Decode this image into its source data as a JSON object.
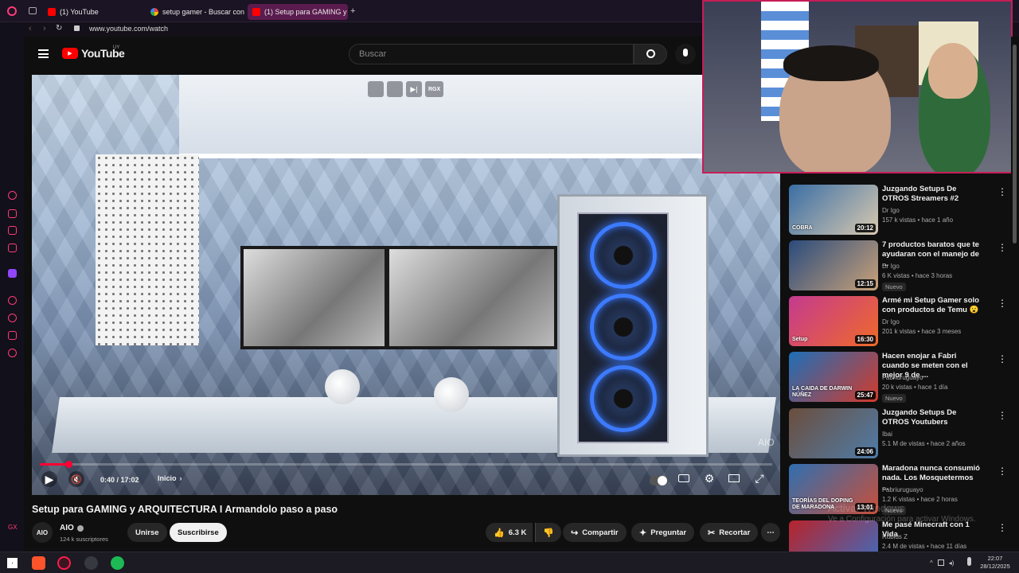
{
  "browser": {
    "tabs": [
      {
        "label": "(1) YouTube"
      },
      {
        "label": "setup gamer - Buscar con"
      },
      {
        "label": "(1) Setup para GAMING y A"
      }
    ],
    "new_tab": "+",
    "url": "www.youtube.com/watch"
  },
  "header": {
    "logo": "YouTube",
    "region": "UY",
    "search_placeholder": "Buscar"
  },
  "player": {
    "overlay_badge": "RGX",
    "time": "0:40 / 17:02",
    "progress": 0.039,
    "chapter": "Inicio",
    "watermark": "AIO"
  },
  "video": {
    "title": "Setup para GAMING y ARQUITECTURA I Armandolo paso a paso",
    "channel": "AIO",
    "channel_avatar": "AIO",
    "subscribers": "124 k suscriptores",
    "join": "Unirse",
    "subscribe": "Suscribirse",
    "likes": "6.3 K",
    "share": "Compartir",
    "ask": "Preguntar",
    "clip": "Recortar"
  },
  "recommendations": [
    {
      "title": "Juzgando Setups De OTROS Streamers #2",
      "channel": "Dr Igo",
      "meta": "157 k vistas • hace 1 año",
      "duration": "20:12",
      "new": "",
      "thumb_text": "COBRA",
      "colors": [
        "#3a6ea5",
        "#d8c9b0"
      ]
    },
    {
      "title": "7 productos baratos que te ayudaran con el manejo de ...",
      "channel": "Dr Igo",
      "meta": "6 K vistas • hace 3 horas",
      "duration": "12:15",
      "new": "Nuevo",
      "thumb_text": "",
      "colors": [
        "#2a4b7c",
        "#c9a27a"
      ]
    },
    {
      "title": "Armé mi Setup Gamer solo con productos de Temu 😮",
      "channel": "Dr Igo",
      "meta": "201 k vistas • hace 3 meses",
      "duration": "16:30",
      "new": "",
      "thumb_text": "Setup",
      "colors": [
        "#c43a8f",
        "#f06a2a"
      ]
    },
    {
      "title": "Hacen enojar a Fabri cuando se meten con el mejor 9 de ...",
      "channel": "Fabriuruguayo",
      "meta": "20 k vistas • hace 1 día",
      "duration": "25:47",
      "new": "Nuevo",
      "thumb_text": "LA CAIDA DE DARWIN NÚÑEZ",
      "colors": [
        "#1d6fb8",
        "#d33a2c"
      ]
    },
    {
      "title": "Juzgando Setups De OTROS Youtubers",
      "channel": "Ibai",
      "meta": "5.1 M de vistas • hace 2 años",
      "duration": "24:06",
      "new": "",
      "thumb_text": "",
      "colors": [
        "#6b4e3d",
        "#4f7ca8"
      ]
    },
    {
      "title": "Maradona nunca consumió nada. Los Mosquetermos ...",
      "channel": "Fabriuruguayo",
      "meta": "1.2 K vistas • hace 2 horas",
      "duration": "13:01",
      "new": "Nuevo",
      "thumb_text": "TEORÍAS DEL DOPING DE MARADONA",
      "colors": [
        "#2f6fb0",
        "#c84f3a"
      ]
    },
    {
      "title": "Me pasé Minecraft con 1 Vida",
      "channel": "Rubius Z",
      "meta": "2.4 M de vistas • hace 11 días",
      "duration": "",
      "new": "",
      "thumb_text": "",
      "colors": [
        "#b8232a",
        "#3a6fc4"
      ]
    }
  ],
  "windows_watermark": {
    "line1": "Activar Windows",
    "line2": "Ve a Configuración para activar Windows."
  },
  "taskbar": {
    "time": "22:07",
    "date": "28/12/2025"
  }
}
